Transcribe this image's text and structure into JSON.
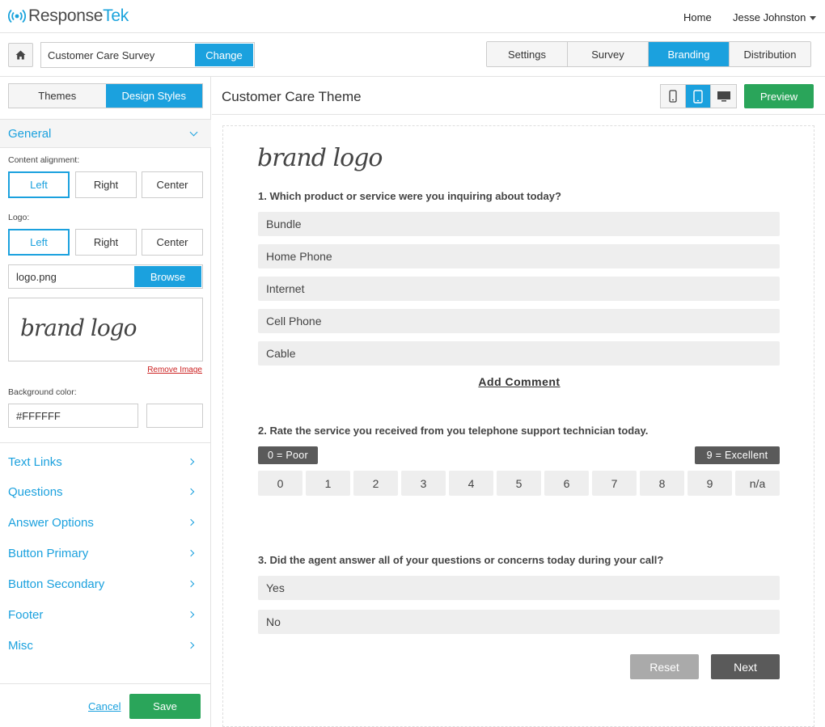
{
  "app": {
    "brand_prefix": "Response",
    "brand_suffix": "Tek",
    "nav_home": "Home",
    "user_name": "Jesse Johnston"
  },
  "toolbar": {
    "survey_name": "Customer Care Survey",
    "change_label": "Change",
    "tabs": [
      "Settings",
      "Survey",
      "Branding",
      "Distribution"
    ],
    "active_tab": "Branding"
  },
  "sidebar": {
    "tabs": [
      "Themes",
      "Design Styles"
    ],
    "active_tab": "Design Styles",
    "general_label": "General",
    "content_alignment_label": "Content alignment:",
    "content_alignment_options": [
      "Left",
      "Right",
      "Center"
    ],
    "content_alignment_selected": "Left",
    "logo_label": "Logo:",
    "logo_alignment_options": [
      "Left",
      "Right",
      "Center"
    ],
    "logo_alignment_selected": "Left",
    "logo_file": "logo.png",
    "browse_label": "Browse",
    "logo_preview_text": "brand logo",
    "remove_image_label": "Remove Image",
    "background_color_label": "Background color:",
    "background_color_value": "#FFFFFF",
    "sections": [
      "Text Links",
      "Questions",
      "Answer Options",
      "Button Primary",
      "Button Secondary",
      "Footer",
      "Misc"
    ],
    "cancel_label": "Cancel",
    "save_label": "Save"
  },
  "main": {
    "title": "Customer Care Theme",
    "preview_label": "Preview",
    "devices": [
      "phone-icon",
      "tablet-icon",
      "desktop-icon"
    ],
    "active_device": "tablet-icon",
    "brand_logo_text": "brand logo",
    "q1": {
      "title": "1. Which product or service were you inquiring about today?",
      "options": [
        "Bundle",
        "Home Phone",
        "Internet",
        "Cell Phone",
        "Cable"
      ],
      "add_comment": "Add Comment"
    },
    "q2": {
      "title": "2. Rate the service you received from you telephone support technician today.",
      "low_label": "0 = Poor",
      "high_label": "9 = Excellent",
      "options": [
        "0",
        "1",
        "2",
        "3",
        "4",
        "5",
        "6",
        "7",
        "8",
        "9",
        "n/a"
      ]
    },
    "q3": {
      "title": "3. Did the agent answer all of your questions or concerns today during your call?",
      "options": [
        "Yes",
        "No"
      ]
    },
    "reset_label": "Reset",
    "next_label": "Next"
  },
  "colors": {
    "accent": "#1ba1de",
    "success": "#2aa55a",
    "dark_button": "#5a5a5a"
  }
}
